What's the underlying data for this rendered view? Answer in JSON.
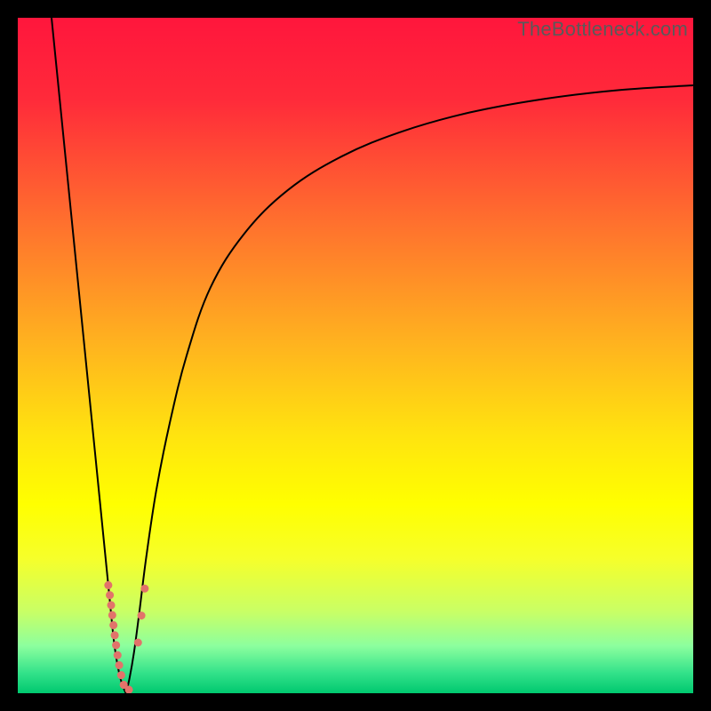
{
  "watermark": "TheBottleneck.com",
  "chart_data": {
    "type": "line",
    "title": "",
    "xlabel": "",
    "ylabel": "",
    "xlim": [
      0,
      100
    ],
    "ylim": [
      0,
      100
    ],
    "background_gradient": {
      "stops": [
        {
          "offset": 0.0,
          "color": "#ff163c"
        },
        {
          "offset": 0.12,
          "color": "#ff2a3a"
        },
        {
          "offset": 0.3,
          "color": "#ff6f2e"
        },
        {
          "offset": 0.48,
          "color": "#ffb21f"
        },
        {
          "offset": 0.62,
          "color": "#ffe40f"
        },
        {
          "offset": 0.72,
          "color": "#ffff00"
        },
        {
          "offset": 0.8,
          "color": "#f6ff2a"
        },
        {
          "offset": 0.88,
          "color": "#c8ff66"
        },
        {
          "offset": 0.93,
          "color": "#8cff9e"
        },
        {
          "offset": 0.97,
          "color": "#33e28a"
        },
        {
          "offset": 1.0,
          "color": "#00c86f"
        }
      ]
    },
    "series": [
      {
        "name": "left_curve",
        "color": "#000000",
        "width": 2.0,
        "points": [
          {
            "x": 5.0,
            "y": 100.0
          },
          {
            "x": 6.0,
            "y": 90.0
          },
          {
            "x": 7.0,
            "y": 80.0
          },
          {
            "x": 8.0,
            "y": 70.0
          },
          {
            "x": 9.0,
            "y": 60.0
          },
          {
            "x": 10.0,
            "y": 50.0
          },
          {
            "x": 11.0,
            "y": 40.0
          },
          {
            "x": 12.0,
            "y": 30.0
          },
          {
            "x": 13.0,
            "y": 20.0
          },
          {
            "x": 13.6,
            "y": 14.0
          },
          {
            "x": 14.2,
            "y": 8.0
          },
          {
            "x": 14.8,
            "y": 4.0
          },
          {
            "x": 15.4,
            "y": 1.5
          },
          {
            "x": 16.0,
            "y": 0.0
          }
        ]
      },
      {
        "name": "right_curve",
        "color": "#000000",
        "width": 2.0,
        "points": [
          {
            "x": 16.0,
            "y": 0.0
          },
          {
            "x": 16.5,
            "y": 2.0
          },
          {
            "x": 17.2,
            "y": 6.0
          },
          {
            "x": 18.0,
            "y": 12.0
          },
          {
            "x": 19.0,
            "y": 20.0
          },
          {
            "x": 20.5,
            "y": 30.0
          },
          {
            "x": 22.5,
            "y": 40.0
          },
          {
            "x": 25.0,
            "y": 50.0
          },
          {
            "x": 28.5,
            "y": 60.0
          },
          {
            "x": 33.5,
            "y": 68.0
          },
          {
            "x": 40.0,
            "y": 74.5
          },
          {
            "x": 48.0,
            "y": 79.5
          },
          {
            "x": 57.0,
            "y": 83.2
          },
          {
            "x": 67.0,
            "y": 86.0
          },
          {
            "x": 78.0,
            "y": 88.0
          },
          {
            "x": 89.0,
            "y": 89.3
          },
          {
            "x": 100.0,
            "y": 90.0
          }
        ]
      },
      {
        "name": "dotted_overlay_left",
        "color": "#e2736a",
        "width": 9.0,
        "style": "dotted_round",
        "points": [
          {
            "x": 13.4,
            "y": 16.0
          },
          {
            "x": 13.7,
            "y": 14.0
          },
          {
            "x": 14.0,
            "y": 11.5
          },
          {
            "x": 14.3,
            "y": 9.0
          },
          {
            "x": 14.6,
            "y": 6.8
          },
          {
            "x": 14.9,
            "y": 4.8
          },
          {
            "x": 15.2,
            "y": 3.2
          },
          {
            "x": 15.5,
            "y": 1.9
          },
          {
            "x": 15.8,
            "y": 0.9
          },
          {
            "x": 16.1,
            "y": 0.3
          },
          {
            "x": 16.5,
            "y": 0.6
          },
          {
            "x": 16.9,
            "y": 1.6
          }
        ]
      },
      {
        "name": "dotted_overlay_right",
        "color": "#e2736a",
        "width": 9.0,
        "style": "dots_spaced",
        "points": [
          {
            "x": 17.8,
            "y": 7.5
          },
          {
            "x": 18.3,
            "y": 11.5
          },
          {
            "x": 18.8,
            "y": 15.5
          }
        ]
      }
    ]
  }
}
